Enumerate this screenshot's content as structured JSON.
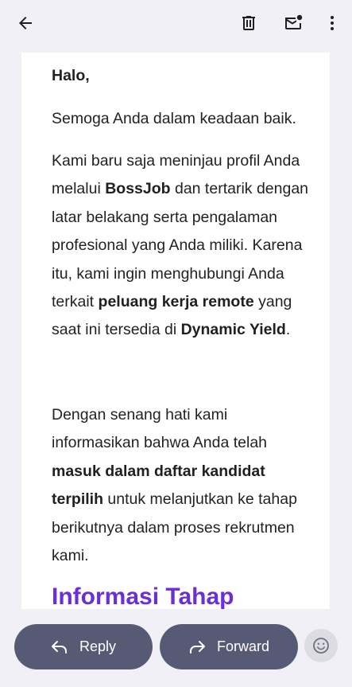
{
  "toolbar": {
    "back_icon": "arrow-left-icon",
    "delete_icon": "trash-icon",
    "unread_icon": "mark-unread-icon",
    "more_icon": "more-vert-icon"
  },
  "email": {
    "greeting": "Halo,",
    "para1": "Semoga Anda dalam keadaan baik.",
    "para2": {
      "t1": "Kami baru saja meninjau profil Anda melalui ",
      "b1": "BossJob",
      "t2": " dan tertarik dengan latar belakang serta pengalaman profesional yang Anda miliki. Karena itu, kami ingin menghubungi Anda terkait ",
      "b2": "peluang kerja remote",
      "t3": " yang saat ini tersedia di ",
      "b3": "Dynamic Yield",
      "t4": "."
    },
    "para3": {
      "t1": "Dengan senang hati kami informasikan bahwa Anda telah ",
      "b1": "masuk dalam daftar kandidat terpilih",
      "t2": " untuk melanjutkan ke tahap berikutnya dalam proses rekrutmen kami."
    },
    "section_heading": "Informasi Tahap"
  },
  "actions": {
    "reply_label": "Reply",
    "forward_label": "Forward",
    "emoji_icon": "emoji-smile-icon"
  },
  "colors": {
    "background": "#f1f0f6",
    "pill": "#575a74",
    "heading_accent": "#6a2fd8"
  }
}
